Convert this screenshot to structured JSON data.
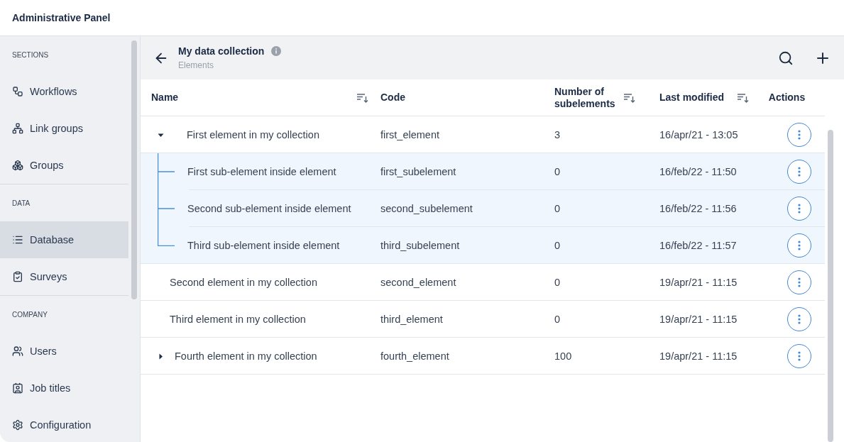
{
  "app_title": "Administrative Panel",
  "sidebar": {
    "sections": [
      {
        "label": "SECTIONS",
        "items": [
          {
            "label": "Workflows",
            "selected": false
          },
          {
            "label": "Link groups",
            "selected": false
          },
          {
            "label": "Groups",
            "selected": false
          }
        ]
      },
      {
        "label": "DATA",
        "items": [
          {
            "label": "Database",
            "selected": true
          },
          {
            "label": "Surveys",
            "selected": false
          }
        ]
      },
      {
        "label": "COMPANY",
        "items": [
          {
            "label": "Users",
            "selected": false
          },
          {
            "label": "Job titles",
            "selected": false
          },
          {
            "label": "Configuration",
            "selected": false
          }
        ]
      }
    ]
  },
  "toolbar": {
    "title": "My data collection",
    "subtitle": "Elements"
  },
  "table": {
    "columns": [
      {
        "label": "Name",
        "sortable": true
      },
      {
        "label": "Code",
        "sortable": false
      },
      {
        "label": "Number of subelements",
        "sortable": true
      },
      {
        "label": "Last modified",
        "sortable": true
      },
      {
        "label": "Actions",
        "sortable": false
      }
    ],
    "rows": [
      {
        "name": "First element in my collection",
        "code": "first_element",
        "count": "3",
        "modified": "16/apr/21 - 13:05",
        "expanded": true,
        "children": [
          {
            "name": "First sub-element inside element",
            "code": "first_subelement",
            "count": "0",
            "modified": "16/feb/22 - 11:50"
          },
          {
            "name": "Second sub-element inside element",
            "code": "second_subelement",
            "count": "0",
            "modified": "16/feb/22 - 11:56"
          },
          {
            "name": "Third sub-element inside element",
            "code": "third_subelement",
            "count": "0",
            "modified": "16/feb/22 - 11:57"
          }
        ]
      },
      {
        "name": "Second element in my collection",
        "code": "second_element",
        "count": "0",
        "modified": "19/apr/21 - 11:15"
      },
      {
        "name": "Third element in my collection",
        "code": "third_element",
        "count": "0",
        "modified": "19/apr/21 - 11:15"
      },
      {
        "name": "Fourth element in my collection",
        "code": "fourth_element",
        "count": "100",
        "modified": "19/apr/21 - 11:15",
        "expanded": false,
        "children": []
      }
    ]
  }
}
